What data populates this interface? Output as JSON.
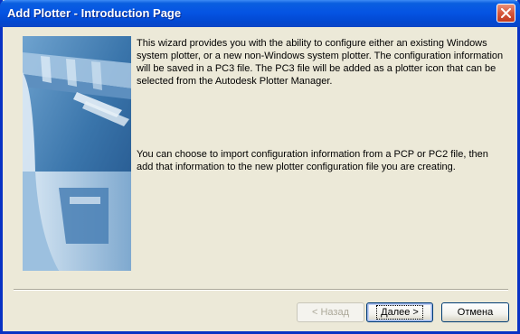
{
  "window": {
    "title": "Add Plotter - Introduction Page"
  },
  "intro": {
    "paragraph1": "This wizard provides you with the ability to configure either an existing Windows system plotter, or a new non-Windows system plotter. The configuration information will be saved in a PC3 file. The PC3 file will be added as a plotter icon that can be selected from the Autodesk Plotter Manager.",
    "paragraph2": "You can choose to import configuration information from a PCP or PC2 file, then add that information to the new plotter configuration file you are creating."
  },
  "buttons": {
    "back": "< Назад",
    "next": "Далее >",
    "cancel": "Отмена"
  },
  "icons": {
    "close": "close-icon",
    "illustration": "plotter-illustration"
  },
  "colors": {
    "titlebar": "#0554e3",
    "window_bg": "#ece9d8",
    "illustration": "#3f79ad"
  }
}
